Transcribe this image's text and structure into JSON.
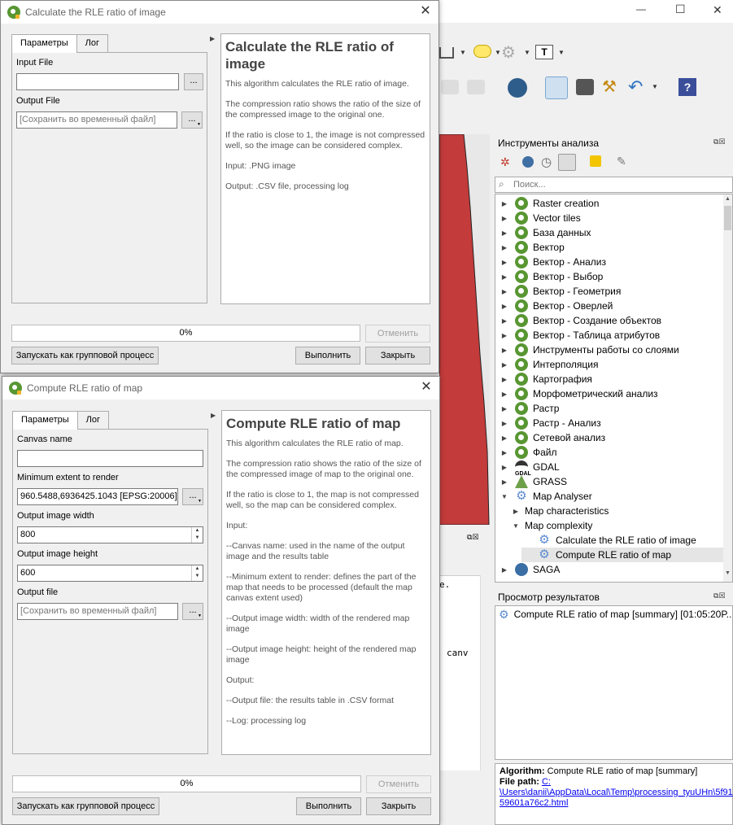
{
  "main_window": {
    "controls": {
      "minimize": "—",
      "maximize": "☐",
      "close": "✕"
    }
  },
  "processing_toolbox": {
    "title": "Инструменты анализа",
    "search_placeholder": "Поиск...",
    "items": [
      {
        "label": "Raster creation",
        "icon": "qgis-icon",
        "level": 0
      },
      {
        "label": "Vector tiles",
        "icon": "qgis-icon",
        "level": 0
      },
      {
        "label": "База данных",
        "icon": "qgis-icon",
        "level": 0
      },
      {
        "label": "Вектор",
        "icon": "qgis-icon",
        "level": 0
      },
      {
        "label": "Вектор - Анализ",
        "icon": "qgis-icon",
        "level": 0
      },
      {
        "label": "Вектор - Выбор",
        "icon": "qgis-icon",
        "level": 0
      },
      {
        "label": "Вектор - Геометрия",
        "icon": "qgis-icon",
        "level": 0
      },
      {
        "label": "Вектор - Оверлей",
        "icon": "qgis-icon",
        "level": 0
      },
      {
        "label": "Вектор - Создание объектов",
        "icon": "qgis-icon",
        "level": 0
      },
      {
        "label": "Вектор - Таблица атрибутов",
        "icon": "qgis-icon",
        "level": 0
      },
      {
        "label": "Инструменты работы со слоями",
        "icon": "qgis-icon",
        "level": 0
      },
      {
        "label": "Интерполяция",
        "icon": "qgis-icon",
        "level": 0
      },
      {
        "label": "Картография",
        "icon": "qgis-icon",
        "level": 0
      },
      {
        "label": "Морфометрический анализ",
        "icon": "qgis-icon",
        "level": 0
      },
      {
        "label": "Растр",
        "icon": "qgis-icon",
        "level": 0
      },
      {
        "label": "Растр - Анализ",
        "icon": "qgis-icon",
        "level": 0
      },
      {
        "label": "Сетевой анализ",
        "icon": "qgis-icon",
        "level": 0
      },
      {
        "label": "Файл",
        "icon": "qgis-icon",
        "level": 0
      },
      {
        "label": "GDAL",
        "icon": "gdal-icon",
        "level": 0
      },
      {
        "label": "GRASS",
        "icon": "grass-icon",
        "level": 0
      },
      {
        "label": "Map Analyser",
        "icon": "gear-icon",
        "level": 0,
        "expanded": true
      },
      {
        "label": "Map characteristics",
        "icon": "",
        "level": 1
      },
      {
        "label": "Map complexity",
        "icon": "",
        "level": 1,
        "expanded": true
      },
      {
        "label": "Calculate the RLE ratio of image",
        "icon": "gear-icon",
        "level": 2
      },
      {
        "label": "Compute RLE ratio of map",
        "icon": "gear-icon",
        "level": 2,
        "selected": true
      },
      {
        "label": "SAGA",
        "icon": "saga-icon",
        "level": 0
      }
    ]
  },
  "results_viewer": {
    "title": "Просмотр результатов",
    "item": "Compute RLE ratio of map [summary] [01:05:20P...",
    "algorithm_label": "Algorithm:",
    "algorithm_value": "Compute RLE ratio of map [summary]",
    "filepath_label": "File path:",
    "filepath_link_1": "C:",
    "filepath_link_2": "\\Users\\danii\\AppData\\Local\\Temp\\processing_tyuUHn\\5f91",
    "filepath_link_3": "59601a76c2.html"
  },
  "console_fragments": {
    "line1": "e.",
    "line2": "canv"
  },
  "dialog1": {
    "title": "Calculate the RLE ratio of image",
    "tab_params": "Параметры",
    "tab_log": "Лог",
    "input_file_label": "Input File",
    "input_file_value": "",
    "output_file_label": "Output File",
    "output_file_placeholder": "[Сохранить во временный файл]",
    "browse": "...",
    "browse_menu": "...",
    "help_title": "Calculate the RLE ratio of image",
    "help_paragraphs": [
      "This algorithm calculates the RLE ratio of image.",
      "The compression ratio shows the ratio of the size of the compressed image to the original one.",
      "If the ratio is close to 1, the image is not compressed well, so the image can be considered complex.",
      "Input: .PNG image",
      "Output: .CSV file, processing log"
    ],
    "progress": "0%",
    "cancel": "Отменить",
    "batch": "Запускать как групповой процесс",
    "run": "Выполнить",
    "close": "Закрыть"
  },
  "dialog2": {
    "title": "Compute RLE ratio of map",
    "tab_params": "Параметры",
    "tab_log": "Лог",
    "canvas_name_label": "Canvas name",
    "canvas_name_value": "",
    "extent_label": "Minimum extent to render",
    "extent_value": "960.5488,6936425.1043 [EPSG:20006]",
    "width_label": "Output image width",
    "width_value": "800",
    "height_label": "Output image height",
    "height_value": "600",
    "output_label": "Output file",
    "output_placeholder": "[Сохранить во временный файл]",
    "browse_menu": "...",
    "help_title": "Compute RLE ratio of map",
    "help_paragraphs": [
      "This algorithm calculates the RLE ratio of map.",
      "The compression ratio shows the ratio of the size of the compressed image of map to the original one.",
      "If the ratio is close to 1, the map is not compressed well, so the map can be considered complex.",
      "Input:",
      "--Canvas name: used in the name of the output image and the results table",
      "--Minimum extent to render: defines the part of the map that needs to be processed (default the map canvas extent used)",
      "--Output image width: width of the rendered map image",
      "--Output image height: height of the rendered map image",
      "Output:",
      "--Output file: the results table in .CSV format",
      "--Log: processing log"
    ],
    "progress": "0%",
    "cancel": "Отменить",
    "batch": "Запускать как групповой процесс",
    "run": "Выполнить",
    "close": "Закрыть"
  },
  "colors": {
    "map_fill": "#c33b3b",
    "qgis_green": "#589632",
    "link": "#0000ee",
    "selection": "#e5e5e5"
  }
}
